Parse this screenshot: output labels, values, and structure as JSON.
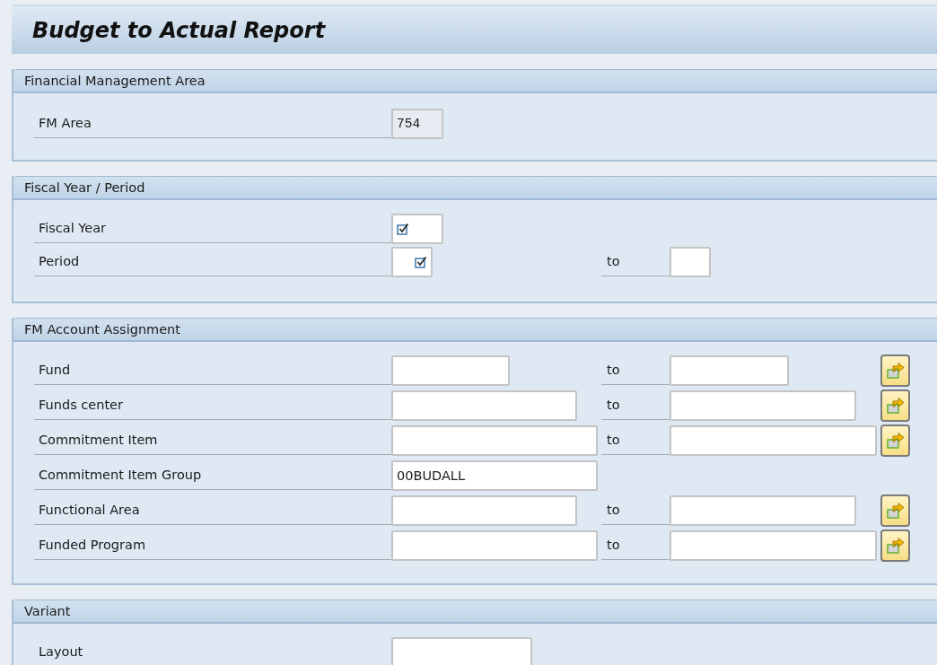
{
  "title": "Budget to Actual Report",
  "sections": [
    {
      "title": "Financial Management Area",
      "rows": [
        {
          "label": "FM Area",
          "low": {
            "value": "754",
            "disabled": true
          }
        }
      ]
    },
    {
      "title": "Fiscal Year / Period",
      "rows": [
        {
          "label": "Fiscal Year",
          "low": {
            "required": true,
            "disabled": false
          }
        },
        {
          "label": "Period",
          "low": {
            "required": true,
            "disabled": false
          },
          "to": "to",
          "high": {
            "disabled": false
          }
        }
      ]
    },
    {
      "title": "FM Account Assignment",
      "rows": [
        {
          "label": "Fund",
          "low": {
            "disabled": false
          },
          "to": "to",
          "high": {
            "disabled": false
          },
          "multiple_selection": true
        },
        {
          "label": "Funds center",
          "low": {
            "disabled": false
          },
          "to": "to",
          "high": {
            "disabled": false
          },
          "multiple_selection": true
        },
        {
          "label": "Commitment Item",
          "low": {
            "disabled": false
          },
          "to": "to",
          "high": {
            "disabled": false
          },
          "multiple_selection": true
        },
        {
          "label": "Commitment Item Group",
          "low": {
            "value": "00BUDALL",
            "disabled": false
          }
        },
        {
          "label": "Functional Area",
          "low": {
            "disabled": false
          },
          "to": "to",
          "high": {
            "disabled": false
          },
          "multiple_selection": true
        },
        {
          "label": "Funded Program",
          "low": {
            "disabled": false
          },
          "to": "to",
          "high": {
            "disabled": false
          },
          "multiple_selection": true
        }
      ]
    },
    {
      "title": "Variant",
      "rows": [
        {
          "label": "Layout",
          "low": {
            "disabled": false
          }
        }
      ]
    }
  ]
}
